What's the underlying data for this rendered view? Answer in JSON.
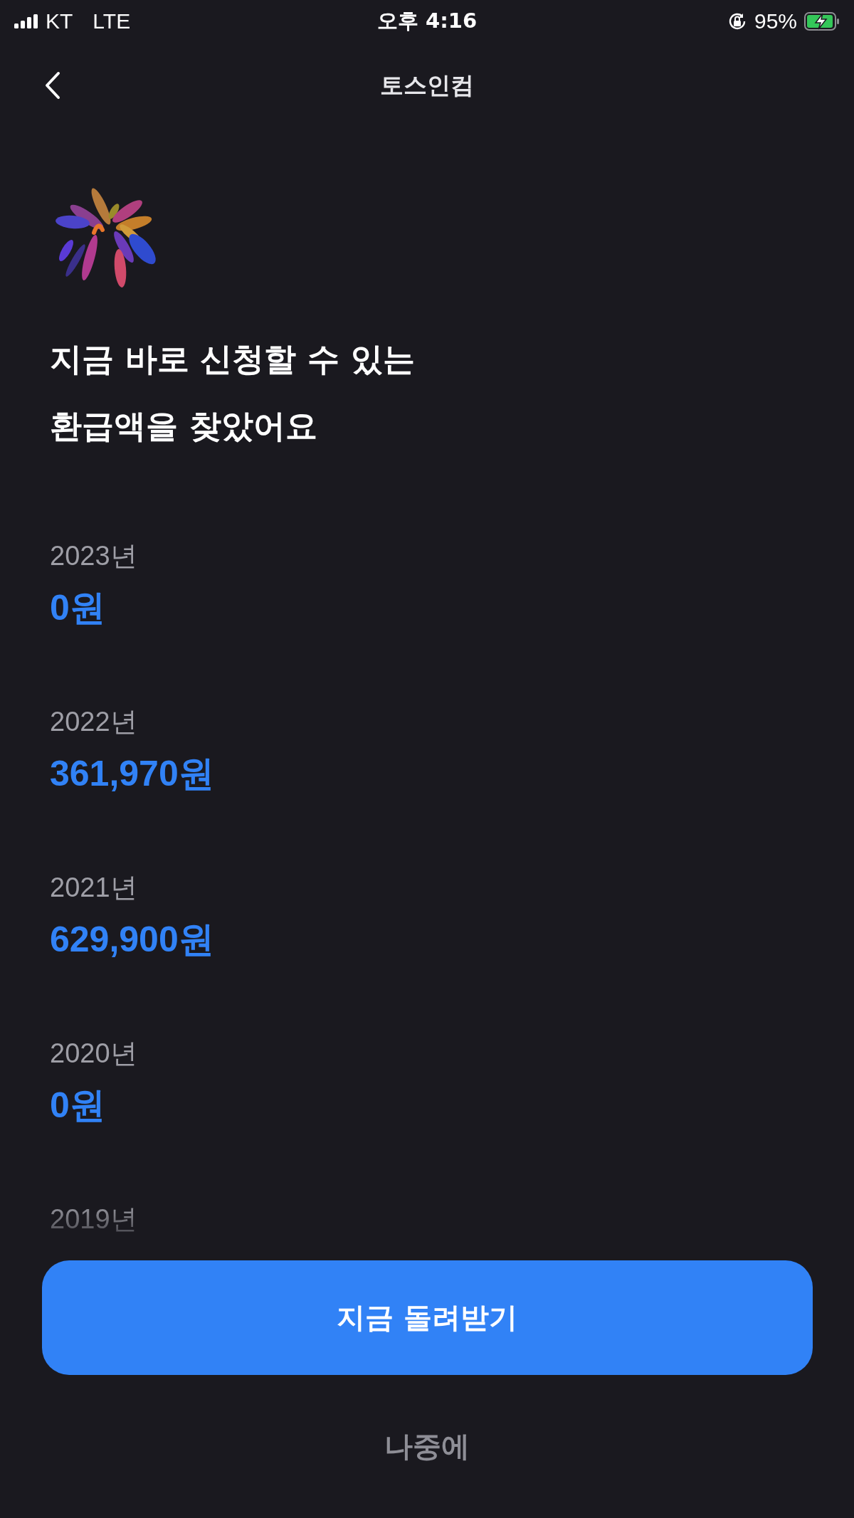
{
  "status_bar": {
    "carrier": "KT",
    "network": "LTE",
    "time": "오후 4:16",
    "battery": "95%"
  },
  "nav": {
    "title": "토스인컴"
  },
  "headline": [
    "지금 바로 신청할 수 있는",
    "환급액을 찾았어요"
  ],
  "refunds": [
    {
      "year": "2023년",
      "amount": "0원"
    },
    {
      "year": "2022년",
      "amount": "361,970원"
    },
    {
      "year": "2021년",
      "amount": "629,900원"
    },
    {
      "year": "2020년",
      "amount": "0원"
    },
    {
      "year": "2019년"
    }
  ],
  "primary_button": "지금 돌려받기",
  "secondary_button": "나중에"
}
